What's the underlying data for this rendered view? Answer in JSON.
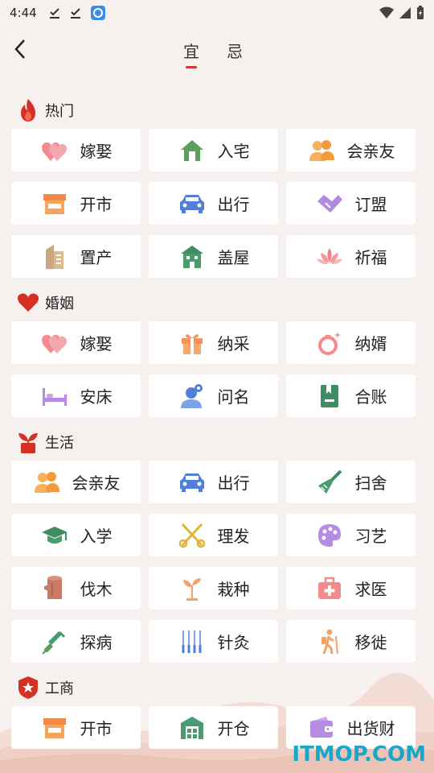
{
  "status": {
    "time": "4:44"
  },
  "header": {
    "tabs": [
      {
        "label": "宜"
      },
      {
        "label": "忌"
      }
    ]
  },
  "sections": [
    {
      "title": "热门",
      "icon": "fire-icon",
      "items": [
        {
          "label": "嫁娶",
          "icon": "hearts-icon"
        },
        {
          "label": "入宅",
          "icon": "house-icon"
        },
        {
          "label": "会亲友",
          "icon": "friends-icon"
        },
        {
          "label": "开市",
          "icon": "shop-icon"
        },
        {
          "label": "出行",
          "icon": "car-icon"
        },
        {
          "label": "订盟",
          "icon": "handshake-icon"
        },
        {
          "label": "置产",
          "icon": "building-icon"
        },
        {
          "label": "盖屋",
          "icon": "construction-icon"
        },
        {
          "label": "祈福",
          "icon": "lotus-icon"
        }
      ]
    },
    {
      "title": "婚姻",
      "icon": "heart-icon",
      "items": [
        {
          "label": "嫁娶",
          "icon": "hearts-icon"
        },
        {
          "label": "纳采",
          "icon": "gift-icon"
        },
        {
          "label": "纳婿",
          "icon": "ring-icon"
        },
        {
          "label": "安床",
          "icon": "bed-icon"
        },
        {
          "label": "问名",
          "icon": "person-icon"
        },
        {
          "label": "合账",
          "icon": "ledger-icon"
        }
      ]
    },
    {
      "title": "生活",
      "icon": "sprout-icon",
      "items": [
        {
          "label": "会亲友",
          "icon": "friends-icon"
        },
        {
          "label": "出行",
          "icon": "car-icon"
        },
        {
          "label": "扫舍",
          "icon": "broom-icon"
        },
        {
          "label": "入学",
          "icon": "graduation-cap-icon"
        },
        {
          "label": "理发",
          "icon": "scissors-icon"
        },
        {
          "label": "习艺",
          "icon": "palette-icon"
        },
        {
          "label": "伐木",
          "icon": "log-icon"
        },
        {
          "label": "栽种",
          "icon": "seedling-icon"
        },
        {
          "label": "求医",
          "icon": "medkit-icon"
        },
        {
          "label": "探病",
          "icon": "syringe-icon"
        },
        {
          "label": "针灸",
          "icon": "needles-icon"
        },
        {
          "label": "移徙",
          "icon": "hiker-icon"
        }
      ]
    },
    {
      "title": "工商",
      "icon": "star-badge-icon",
      "items": [
        {
          "label": "开市",
          "icon": "shop-icon"
        },
        {
          "label": "开仓",
          "icon": "warehouse-icon"
        },
        {
          "label": "出货财",
          "icon": "wallet-icon"
        }
      ]
    }
  ],
  "watermark": "ITMOP.COM",
  "colors": {
    "accent": "#d33a2c",
    "background": "#f6f1ef",
    "card": "#ffffff",
    "watermark": "#19a6c8"
  }
}
